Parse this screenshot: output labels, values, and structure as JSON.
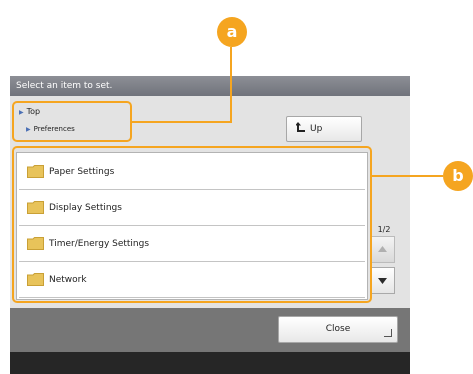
{
  "title_bar": {
    "text": "Select an item to set."
  },
  "breadcrumb": {
    "top": "Top",
    "current": "Preferences"
  },
  "up_button": {
    "label": "Up"
  },
  "menu_items": [
    {
      "label": "Paper Settings",
      "icon": "folder-icon"
    },
    {
      "label": "Display Settings",
      "icon": "folder-icon"
    },
    {
      "label": "Timer/Energy Settings",
      "icon": "folder-icon"
    },
    {
      "label": "Network",
      "icon": "folder-icon"
    }
  ],
  "pagination": {
    "indicator": "1/2"
  },
  "close_button": {
    "label": "Close"
  },
  "callouts": {
    "a": "a",
    "b": "b"
  },
  "colors": {
    "callout": "#f5a520",
    "title_bar": "#7c7f87",
    "panel": "#e3e3e3",
    "footer": "#767676",
    "folder": "#e8c35a"
  }
}
